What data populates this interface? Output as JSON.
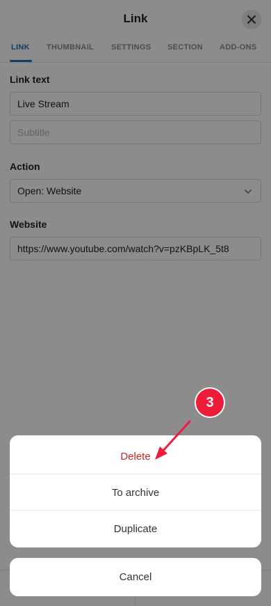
{
  "header": {
    "title": "Link",
    "close_icon": "close-icon"
  },
  "tabs": [
    {
      "label": "LINK",
      "active": true
    },
    {
      "label": "THUMBNAIL",
      "active": false
    },
    {
      "label": "SETTINGS",
      "active": false
    },
    {
      "label": "SECTION",
      "active": false
    },
    {
      "label": "ADD-ONS",
      "active": false
    }
  ],
  "form": {
    "link_text_label": "Link text",
    "link_text_value": "Live Stream",
    "subtitle_placeholder": "Subtitle",
    "action_label": "Action",
    "action_value": "Open: Website",
    "website_label": "Website",
    "website_value": "https://www.youtube.com/watch?v=pzKBpLK_5t8"
  },
  "action_sheet": {
    "items": [
      {
        "label": "Delete",
        "destructive": true
      },
      {
        "label": "To archive",
        "destructive": false
      },
      {
        "label": "Duplicate",
        "destructive": false
      }
    ],
    "cancel_label": "Cancel"
  },
  "annotation": {
    "step_number": "3",
    "badge_color": "#ee1c3a"
  },
  "colors": {
    "accent": "#1f6fb8",
    "destructive": "#c62828"
  }
}
